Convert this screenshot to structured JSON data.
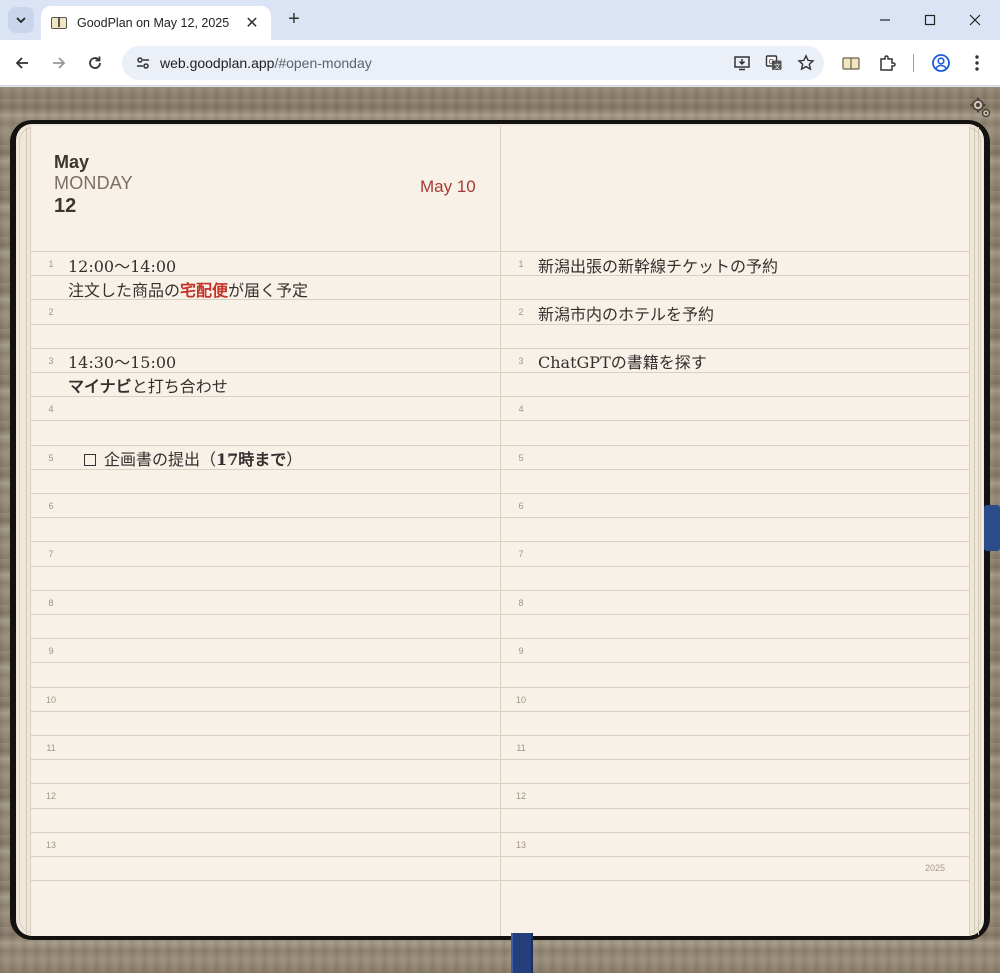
{
  "browser": {
    "tab_title": "GoodPlan on May 12, 2025",
    "url_host": "web.goodplan.app",
    "url_path": "/#open-monday"
  },
  "planner": {
    "month": "May",
    "weekday": "MONDAY",
    "day": "12",
    "header_date": "May 10",
    "year_footer": "2025",
    "left_lines": {
      "1": "1",
      "2": "2",
      "3": "3",
      "4": "4",
      "5": "5",
      "6": "6",
      "7": "7",
      "8": "8",
      "9": "9",
      "10": "10",
      "11": "11",
      "12": "12",
      "13": "13"
    },
    "left_entries": {
      "e1_time": "12:00〜14:00",
      "e1_pre": "注文した商品の",
      "e1_highlight": "宅配便",
      "e1_post": "が届く予定",
      "e2_time": "14:30〜15:00",
      "e2_bold": "マイナビ",
      "e2_post": "と打ち合わせ",
      "task_pre": "企画書の提出（",
      "task_bold": "17時まで",
      "task_post": "）"
    },
    "right_entries": {
      "r1": "新潟出張の新幹線チケットの予約",
      "r2": "新潟市内のホテルを予約",
      "r3": "ChatGPTの書籍を探す"
    }
  }
}
